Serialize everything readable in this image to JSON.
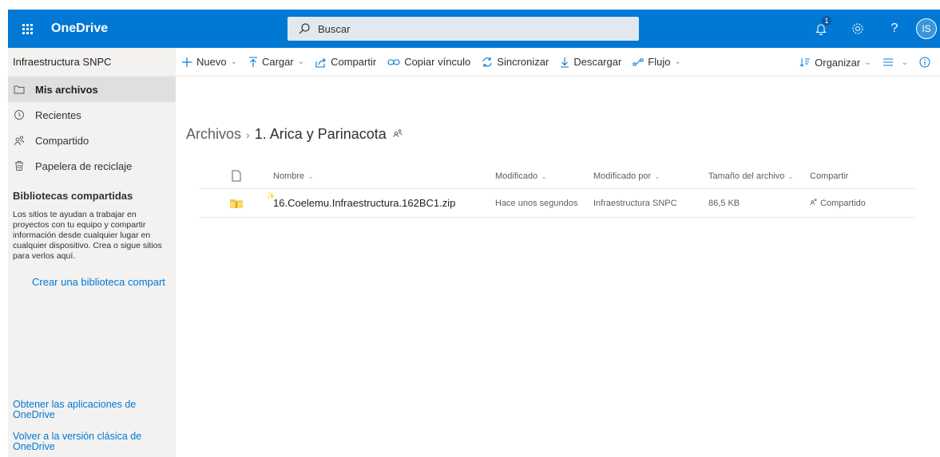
{
  "app": {
    "name": "OneDrive",
    "accent": "#0078d4"
  },
  "search": {
    "placeholder": "Buscar"
  },
  "topbar": {
    "notifications_count": "1",
    "help_label": "?",
    "avatar_initials": "IS"
  },
  "sidebar": {
    "title": "Infraestructura SNPC",
    "items": [
      {
        "label": "Mis archivos",
        "icon": "folder-icon",
        "active": true
      },
      {
        "label": "Recientes",
        "icon": "clock-icon",
        "active": false
      },
      {
        "label": "Compartido",
        "icon": "people-icon",
        "active": false
      },
      {
        "label": "Papelera de reciclaje",
        "icon": "recycle-bin-icon",
        "active": false
      }
    ],
    "shared_libraries_heading": "Bibliotecas compartidas",
    "shared_libraries_desc": "Los sitios te ayudan a trabajar en proyectos con tu equipo y compartir información desde cualquier lugar en cualquier dispositivo. Crea o sigue sitios para verlos aquí.",
    "create_library_link": "Crear una biblioteca compart",
    "get_apps_link": "Obtener las aplicaciones de OneDrive",
    "classic_link": "Volver a la versión clásica de OneDrive"
  },
  "commandbar": {
    "nuevo": "Nuevo",
    "cargar": "Cargar",
    "compartir": "Compartir",
    "copiar": "Copiar vínculo",
    "sincronizar": "Sincronizar",
    "descargar": "Descargar",
    "flujo": "Flujo",
    "organizar": "Organizar"
  },
  "breadcrumb": {
    "root": "Archivos",
    "current": "1. Arica y Parinacota"
  },
  "filelist": {
    "columns": {
      "name": "Nombre",
      "modified": "Modificado",
      "modified_by": "Modificado por",
      "size": "Tamaño del archivo",
      "sharing": "Compartir"
    },
    "rows": [
      {
        "name": "16.Coelemu.Infraestructura.162BC1.zip",
        "modified": "Hace unos segundos",
        "modified_by": "Infraestructura SNPC",
        "size": "86,5 KB",
        "sharing": "Compartido"
      }
    ]
  }
}
